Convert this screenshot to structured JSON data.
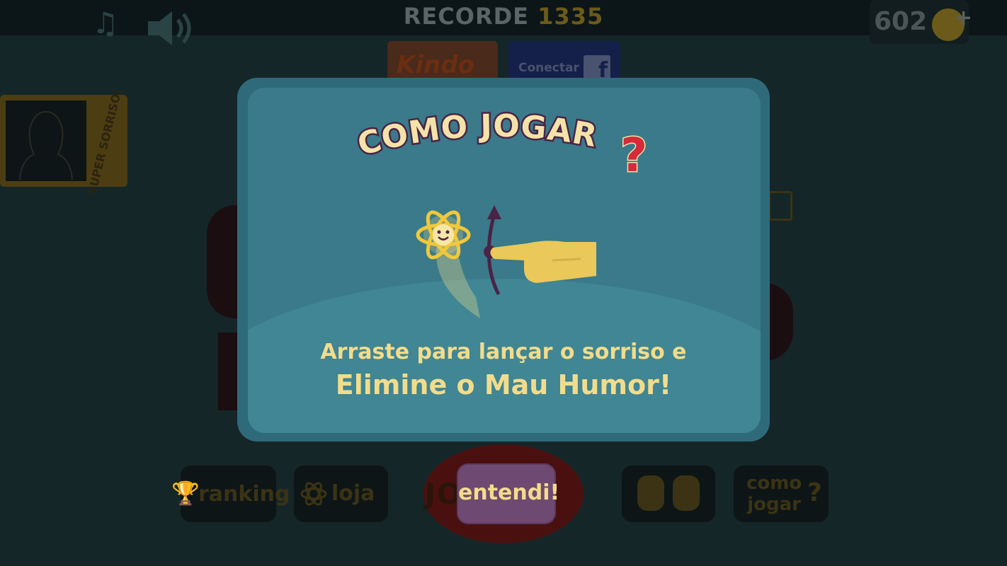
{
  "header": {
    "record_label": "RECORDE",
    "record_value": "1335",
    "coins": "602",
    "coin_plus": "+"
  },
  "top_buttons": {
    "kindo_label": "Kindo",
    "facebook_label": "Conectar",
    "facebook_glyph": "f"
  },
  "profile": {
    "badge_text": "SUPER SORRISO!"
  },
  "bottom_menu": {
    "ranking_label": "ranking",
    "loja_label": "loja",
    "play_label": "JOGAR",
    "como_label_1": "como",
    "como_label_2": "jogar",
    "como_q": "?"
  },
  "modal": {
    "title": "COMO JOGAR",
    "title_mark": "?",
    "instruction_line1": "Arraste para lançar o sorriso e",
    "instruction_line2": "Elimine o Mau Humor!",
    "confirm_label": "entendi!"
  },
  "colors": {
    "modal_bg": "#3a7a8a",
    "text_yellow": "#f2dc8c",
    "title_fill": "#f4e3a8",
    "title_outline": "#4a2346",
    "question_red": "#d42a3a",
    "button_purple": "#6e4a72"
  },
  "icons": [
    "music-note-icon",
    "speaker-icon",
    "coin-icon",
    "plus-icon",
    "facebook-icon",
    "trophy-icon",
    "atom-icon",
    "duo-characters-icon",
    "question-icon",
    "smile-atom-icon",
    "swipe-hand-icon",
    "swipe-arrow-icon"
  ]
}
